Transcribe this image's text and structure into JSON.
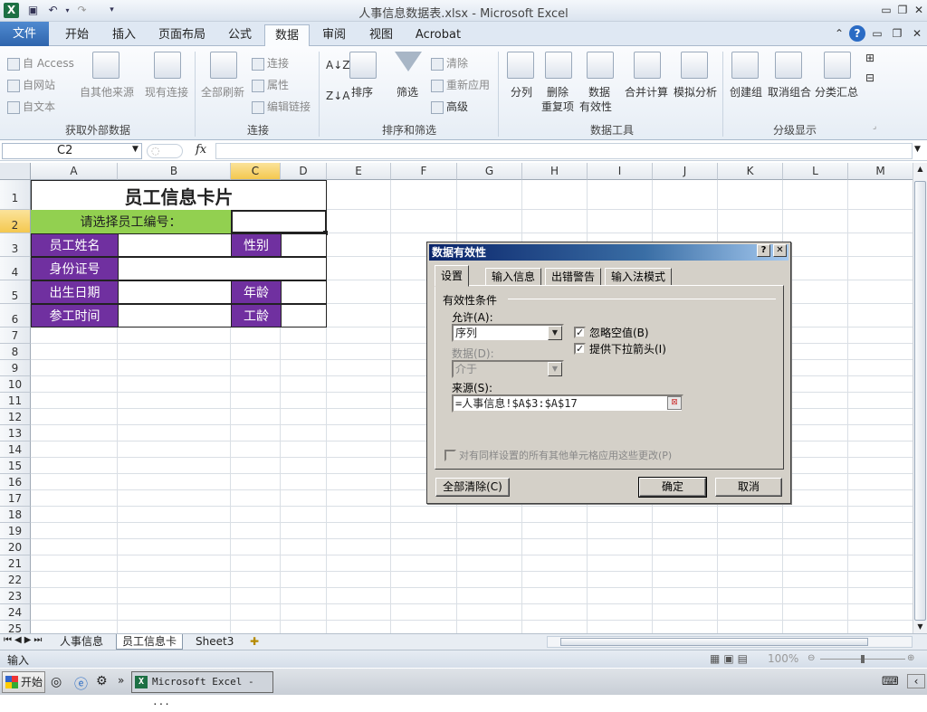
{
  "window": {
    "title": "人事信息数据表.xlsx  -  Microsoft Excel"
  },
  "ribbon_tabs": [
    "文件",
    "开始",
    "插入",
    "页面布局",
    "公式",
    "数据",
    "审阅",
    "视图",
    "Acrobat"
  ],
  "ribbon": {
    "ext": {
      "access": "自 Access",
      "web": "自网站",
      "text": "自文本",
      "other": "自其他来源",
      "existing": "现有连接",
      "label": "获取外部数据"
    },
    "conn": {
      "refresh": "全部刷新",
      "connections": "连接",
      "props": "属性",
      "editlinks": "编辑链接",
      "label": "连接"
    },
    "sort": {
      "sort": "排序",
      "filter": "筛选",
      "clear": "清除",
      "reapply": "重新应用",
      "advanced": "高级",
      "label": "排序和筛选"
    },
    "tools": {
      "split": "分列",
      "remove1": "删除",
      "remove2": "重复项",
      "valid1": "数据",
      "valid2": "有效性",
      "consol": "合并计算",
      "whatif": "模拟分析",
      "label": "数据工具"
    },
    "outline": {
      "group": "创建组",
      "ungroup": "取消组合",
      "subtotal": "分类汇总",
      "label": "分级显示"
    }
  },
  "formula": {
    "namebox": "C2",
    "fx": "fx"
  },
  "columns": [
    "A",
    "B",
    "C",
    "D",
    "E",
    "F",
    "G",
    "H",
    "I",
    "J",
    "K",
    "L",
    "M"
  ],
  "rows": [
    "1",
    "2",
    "3",
    "4",
    "5",
    "6",
    "7",
    "8",
    "9",
    "10",
    "11",
    "12",
    "13",
    "14",
    "15",
    "16",
    "17",
    "18",
    "19",
    "20",
    "21",
    "22",
    "23",
    "24",
    "25"
  ],
  "card": {
    "title": "员工信息卡片",
    "prompt": "请选择员工编号：",
    "name": "员工姓名",
    "gender": "性别",
    "id": "身份证号",
    "birth": "出生日期",
    "age": "年龄",
    "join": "参工时间",
    "tenure": "工龄"
  },
  "sheets": [
    "人事信息",
    "员工信息卡",
    "Sheet3"
  ],
  "status": {
    "mode": "输入",
    "zoom": "100%"
  },
  "taskbar": {
    "start": "开始",
    "app": "Microsoft Excel - ..."
  },
  "dialog": {
    "title": "数据有效性",
    "tabs": [
      "设置",
      "输入信息",
      "出错警告",
      "输入法模式"
    ],
    "section": "有效性条件",
    "allow_label": "允许(A):",
    "allow_value": "序列",
    "data_label": "数据(D):",
    "data_value": "介于",
    "ignore_blank": "忽略空值(B)",
    "dropdown": "提供下拉箭头(I)",
    "source_label": "来源(S):",
    "source_value": "=人事信息!$A$3:$A$17",
    "apply_all": "对有同样设置的所有其他单元格应用这些更改(P)",
    "clear_all": "全部清除(C)",
    "ok": "确定",
    "cancel": "取消"
  }
}
